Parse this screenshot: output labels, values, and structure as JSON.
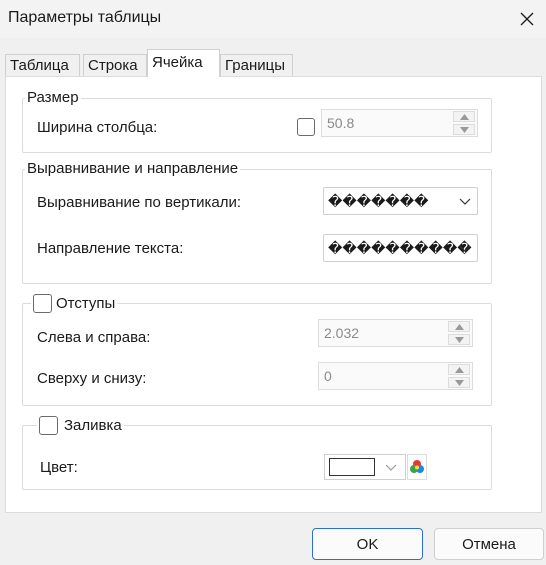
{
  "window": {
    "title": "Параметры таблицы"
  },
  "tabs": [
    {
      "label": "Таблица"
    },
    {
      "label": "Строка"
    },
    {
      "label": "Ячейка"
    },
    {
      "label": "Границы"
    }
  ],
  "active_tab": "Ячейка",
  "size_group": {
    "legend": "Размер",
    "column_width_label": "Ширина столбца:",
    "column_width_value": "50.8",
    "column_width_checked": false
  },
  "align_group": {
    "legend": "Выравнивание и направление",
    "vertical_label": "Выравнивание по вертикали:",
    "vertical_value": "�������",
    "direction_label": "Направление текста:",
    "direction_value": "����������"
  },
  "padding_group": {
    "legend": "Отступы",
    "checked": false,
    "left_right_label": "Слева и справа:",
    "left_right_value": "2.032",
    "top_bottom_label": "Сверху и снизу:",
    "top_bottom_value": "0"
  },
  "fill_group": {
    "legend": "Заливка",
    "checked": false,
    "color_label": "Цвет:",
    "color_value": "#ffffff"
  },
  "buttons": {
    "ok": "OK",
    "cancel": "Отмена"
  },
  "colors": {
    "accent": "#2b6fd6",
    "border": "#dcdcdc",
    "background": "#f0f0f0"
  }
}
